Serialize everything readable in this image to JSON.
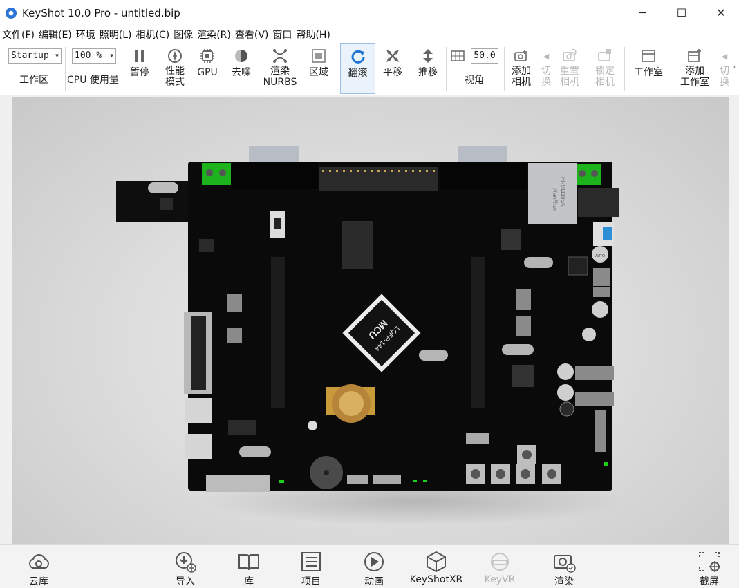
{
  "window": {
    "title": "KeyShot 10.0 Pro  - untitled.bip",
    "minimize_glyph": "─",
    "maximize_glyph": "☐",
    "close_glyph": "✕"
  },
  "menu": [
    "文件(F)",
    "编辑(E)",
    "环境",
    "照明(L)",
    "相机(C)",
    "图像",
    "渲染(R)",
    "查看(V)",
    "窗口",
    "帮助(H)"
  ],
  "toolbar": {
    "workspace_value": "Startup",
    "workspace_label": "工作区",
    "cpu_value": "100 %",
    "cpu_label": "CPU 使用量",
    "pause_label": "暂停",
    "perf_label_1": "性能",
    "perf_label_2": "模式",
    "gpu_label": "GPU",
    "denoise_label": "去噪",
    "nurbs_label_1": "渲染",
    "nurbs_label_2": "NURBS",
    "region_label": "区域",
    "tumble_label": "翻滚",
    "pan_label": "平移",
    "dolly_label": "推移",
    "fov_value": "50.0",
    "fov_label": "视角",
    "add_camera_1": "添加",
    "add_camera_2": "相机",
    "switch_1": "切",
    "switch_2": "换",
    "reset_camera_1": "重置",
    "reset_camera_2": "相机",
    "lock_camera_1": "锁定",
    "lock_camera_2": "相机",
    "studio_label": "工作室",
    "add_studio_1": "添加",
    "add_studio_2": "工作室",
    "switch2_1": "切",
    "switch2_2": "换"
  },
  "pcb": {
    "chip_text_1": "MCU",
    "chip_text_2": "LQFP-144",
    "rj45_text_1": "HR911105A",
    "rj45_text_2": "HanRun",
    "cap_text": "AUTO"
  },
  "bottom": {
    "cloud": "云库",
    "import": "导入",
    "library": "库",
    "project": "项目",
    "animation": "动画",
    "keyshotxr": "KeyShotXR",
    "keyvr": "KeyVR",
    "render": "渲染",
    "screenshot": "截屏"
  }
}
